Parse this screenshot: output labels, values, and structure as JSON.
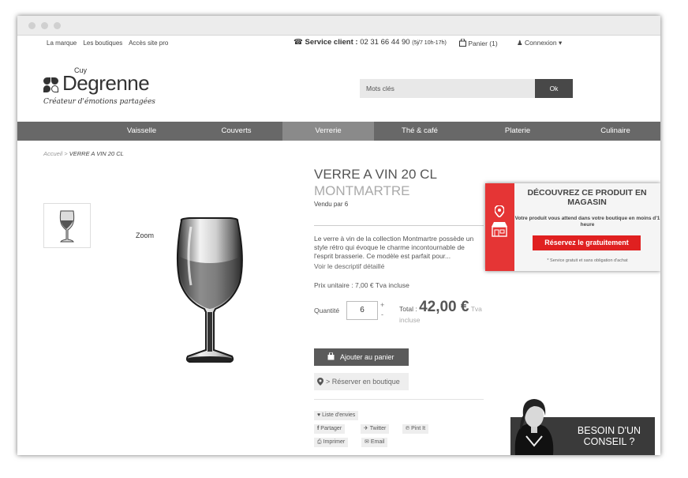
{
  "topbar": {
    "links": [
      "La marque",
      "Les boutiques",
      "Accès site pro"
    ],
    "service_label": "Service client :",
    "service_phone": "02 31 66 44 90",
    "service_hours": "(5j/7 10h-17h)",
    "cart": "Panier (1)",
    "login": "Connexion"
  },
  "logo": {
    "cuy": "Cuy",
    "brand": "Degrenne",
    "tagline": "Créateur d'émotions partagées"
  },
  "search": {
    "placeholder": "Mots clés",
    "button": "Ok"
  },
  "nav": {
    "items": [
      "Vaisselle",
      "Couverts",
      "Verrerie",
      "Thé & café",
      "Platerie",
      "Culinaire"
    ],
    "active": "Verrerie"
  },
  "breadcrumb": {
    "home": "Accueil",
    "separator": ">",
    "current": "VERRE A VIN 20 CL"
  },
  "gallery": {
    "zoom_label": "Zoom"
  },
  "product": {
    "title": "VERRE A VIN 20 CL",
    "collection": "MONTMARTRE",
    "pack": "Vendu par 6",
    "description": "Le verre à vin de la collection Montmartre possède un style rétro qui évoque le charme incontournable de l'esprit brasserie. Ce modèle est parfait pour...",
    "more_link": "Voir le descriptif détaillé",
    "unit_price": "Prix unitaire : 7,00 € Tva incluse",
    "quantity_label": "Quantité",
    "quantity_value": "6",
    "plus": "+",
    "minus": "-",
    "total_label": "Total :",
    "total_amount": "42,00 €",
    "total_tva": "Tva",
    "total_incl": "incluse",
    "add_to_cart": "Ajouter au panier",
    "reserve": "> Réserver en boutique"
  },
  "social": {
    "wishlist": "Liste d'envies",
    "share": "Partager",
    "twitter": "Twitter",
    "pinterest": "Pint It",
    "print": "Imprimer",
    "email": "Email"
  },
  "popup": {
    "heading": "DÉCOUVREZ CE PRODUIT EN MAGASIN",
    "line": "Votre produit vous attend dans votre boutique en moins d'1 heure",
    "button": "Réservez le gratuitement",
    "note": "* Service gratuit et sans obligation d'achat"
  },
  "conseil": {
    "text": "BESOIN D'UN CONSEIL ?"
  },
  "colors": {
    "nav_bg": "#686868",
    "popup_red": "#e53535",
    "button_dark": "#5a5a5a"
  }
}
